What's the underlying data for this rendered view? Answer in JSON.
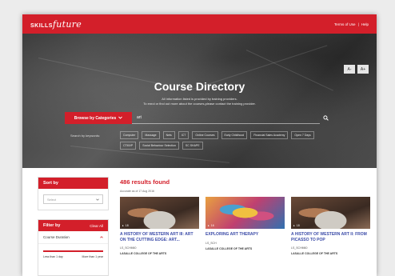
{
  "header": {
    "logo_skills": "SKILLS",
    "logo_future": "future",
    "links": [
      "Terms of Use",
      "|",
      "Help"
    ]
  },
  "font_controls": [
    "A-",
    "A+"
  ],
  "hero": {
    "title": "Course Directory",
    "sub1": "All information listed is provided by training providers.",
    "sub2": "To enrol or find out more about the courses,please contact the training provider."
  },
  "search": {
    "browse_label": "Browse by Categories",
    "value": "art",
    "keywords_label": "Search by keywords:",
    "keywords_row1": [
      "Computer",
      "Massage",
      "Nets",
      "ICT",
      "Online Courses",
      "Early Childhood",
      "Financial Sales Academy",
      "Open 7 Days"
    ],
    "keywords_row2": [
      "CTMVP",
      "Social Behaviour Selection",
      "SC SHAPE"
    ]
  },
  "sidebar": {
    "sort_title": "Sort by",
    "sort_placeholder": "Select",
    "filter_title": "Filter by",
    "clear_all": "Clear All",
    "duration_label": "Course Duration",
    "duration_min": "Less than 1 day",
    "duration_max": "More than 1 year"
  },
  "results": {
    "count_text": "486 results found",
    "accurate_text": "Accurate as of 17 Aug 2016"
  },
  "courses": [
    {
      "title": "A HISTORY OF WESTERN ART III: ART ON THE CUTTING EDGE: ART...",
      "code": "LS_SCHM60",
      "provider": "LASALLE COLLEGE OF THE ARTS",
      "meta": "18"
    },
    {
      "title": "EXPLORING ART THERAPY",
      "code": "LS_SCH",
      "provider": "LASALLE COLLEGE OF THE ARTS",
      "meta": "16"
    },
    {
      "title": "A HISTORY OF WESTERN ART II: FROM PICASSO TO POP",
      "code": "LS_SCHM60",
      "provider": "LASALLE COLLEGE OF THE ARTS",
      "meta": "18"
    }
  ],
  "colors": {
    "brand_red": "#d31f2a",
    "title_blue": "#3b4ba8"
  }
}
